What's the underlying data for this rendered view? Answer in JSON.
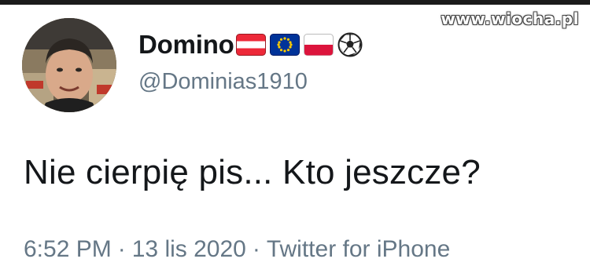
{
  "watermark": "www.wiocha.pl",
  "tweet": {
    "display_name": "Domino",
    "name_emojis": [
      "austria-flag-icon",
      "eu-flag-icon",
      "poland-flag-icon",
      "soccer-ball-icon"
    ],
    "handle": "@Dominias1910",
    "text": "Nie cierpię pis... Kto jeszcze?",
    "time": "6:52 PM",
    "separator": "·",
    "date": "13 lis 2020",
    "client": "Twitter for iPhone"
  },
  "colors": {
    "text_primary": "#14171a",
    "text_secondary": "#657786",
    "background": "#ffffff"
  }
}
